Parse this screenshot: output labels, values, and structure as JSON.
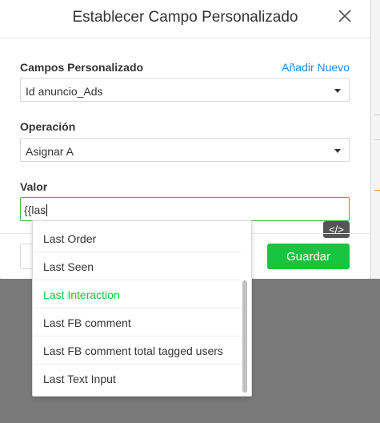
{
  "modal": {
    "title": "Establecer Campo Personalizado",
    "close_icon": "close-icon"
  },
  "custom_field": {
    "label": "Campos Personalizado",
    "add_new": "Añadir Nuevo",
    "selected": "Id anuncio_Ads"
  },
  "operation": {
    "label": "Operación",
    "selected": "Asignar A"
  },
  "value": {
    "label": "Valor",
    "text": "{{las"
  },
  "code_button": {
    "icon": "code-icon",
    "label": "</>"
  },
  "footer": {
    "save_label": "Guardar"
  },
  "dropdown": {
    "items": [
      "Last Order",
      "Last Seen",
      "Last Interaction",
      "Last FB comment",
      "Last FB comment total tagged users",
      "Last Text Input"
    ],
    "active_index": 2
  },
  "colors": {
    "accent_green": "#16c43f",
    "link_blue": "#1e88e5",
    "focus_border": "#4caf50"
  }
}
